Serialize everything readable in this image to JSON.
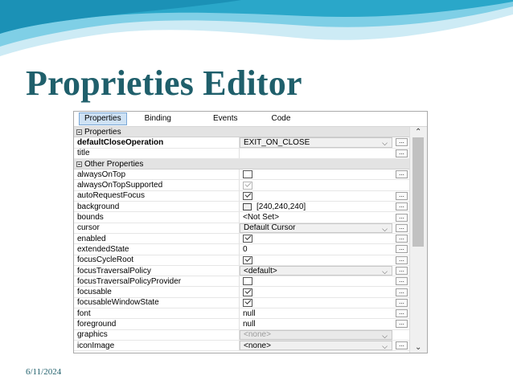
{
  "slide": {
    "title": "Proprieties Editor",
    "date": "6/11/2024"
  },
  "tabs": [
    "Properties",
    "Binding",
    "Events",
    "Code"
  ],
  "categories": {
    "properties": "Properties",
    "other": "Other Properties"
  },
  "rows": {
    "defaultCloseOperation": {
      "name": "defaultCloseOperation",
      "value": "EXIT_ON_CLOSE"
    },
    "title": {
      "name": "title",
      "value": ""
    },
    "alwaysOnTop": {
      "name": "alwaysOnTop",
      "checked": false
    },
    "alwaysOnTopSupported": {
      "name": "alwaysOnTopSupported",
      "checked": true
    },
    "autoRequestFocus": {
      "name": "autoRequestFocus",
      "checked": true
    },
    "background": {
      "name": "background",
      "value": "[240,240,240]",
      "color": "#f0f0f0"
    },
    "bounds": {
      "name": "bounds",
      "value": "<Not Set>"
    },
    "cursor": {
      "name": "cursor",
      "value": "Default Cursor"
    },
    "enabled": {
      "name": "enabled",
      "checked": true
    },
    "extendedState": {
      "name": "extendedState",
      "value": "0"
    },
    "focusCycleRoot": {
      "name": "focusCycleRoot",
      "checked": true
    },
    "focusTraversalPolicy": {
      "name": "focusTraversalPolicy",
      "value": "<default>"
    },
    "focusTraversalPolicyProvider": {
      "name": "focusTraversalPolicyProvider",
      "checked": false
    },
    "focusable": {
      "name": "focusable",
      "checked": true
    },
    "focusableWindowState": {
      "name": "focusableWindowState",
      "checked": true
    },
    "font": {
      "name": "font",
      "value": "null"
    },
    "foreground": {
      "name": "foreground",
      "value": "null"
    },
    "graphics": {
      "name": "graphics",
      "value": "<none>"
    },
    "iconImage": {
      "name": "iconImage",
      "value": "<none>"
    }
  },
  "glyphs": {
    "ellipsis": "...",
    "drop": "⌵",
    "up": "⌃",
    "down": "⌄",
    "collapse": "−"
  },
  "colors": {
    "title": "#1f5f6b",
    "wave_dark": "#2aa7c9",
    "wave_light": "#bfe6f2",
    "tab_active": "#cfe2f4"
  }
}
